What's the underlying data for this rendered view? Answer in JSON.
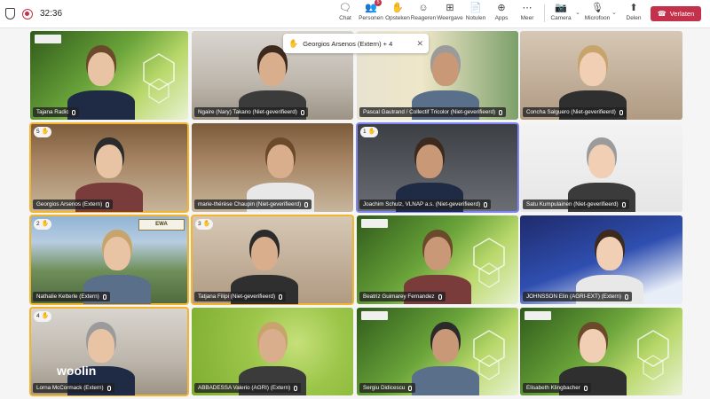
{
  "window": {
    "timer": "32:36"
  },
  "toolbar": {
    "chat": "Chat",
    "people": "Personen",
    "people_badge": "5",
    "raise": "Opsteken",
    "react": "Reageren",
    "view": "Weergave",
    "notes": "Notulen",
    "apps": "Apps",
    "more": "Meer",
    "camera": "Camera",
    "mic": "Microfoon",
    "share": "Delen",
    "leave": "Verlaten"
  },
  "raised_banner": {
    "text": "Georgios Arsenos (Extern) + 4"
  },
  "colors": {
    "leave": "#c4314b",
    "speaking": "#f3b52d",
    "selected": "#7f85f5"
  },
  "participants": [
    {
      "name": "Tajana Radic",
      "bg": "plant",
      "hand": ""
    },
    {
      "name": "Ngaire (Nary) Takano (Niet-geverifieerd)",
      "bg": "office",
      "hand": ""
    },
    {
      "name": "Pascal Gautrand / Collectif Tricolor (Niet-geverifieerd)",
      "bg": "poster",
      "hand": ""
    },
    {
      "name": "Concha Salguero (Niet-geverifieerd)",
      "bg": "room",
      "hand": ""
    },
    {
      "name": "Georgios Arsenos (Extern)",
      "bg": "books",
      "hand": "5"
    },
    {
      "name": "marie-thérèse Chaupin (Niet-geverifieerd)",
      "bg": "books",
      "hand": ""
    },
    {
      "name": "Joachim Schulz, VLNAP a.s. (Niet-geverifieerd)",
      "bg": "dark",
      "hand": "1"
    },
    {
      "name": "Satu Kumpulainen (Niet-geverifieerd)",
      "bg": "white",
      "hand": ""
    },
    {
      "name": "Nathalie Ketterle (Extern)",
      "bg": "mountain",
      "hand": "2"
    },
    {
      "name": "Tatjana Filipi (Niet-geverifieerd)",
      "bg": "room",
      "hand": "3"
    },
    {
      "name": "Beatriz Guimarey Fernandez",
      "bg": "plant",
      "hand": ""
    },
    {
      "name": "JOHNSSON Elin (AGRI-EXT) (Extern)",
      "bg": "blue",
      "hand": ""
    },
    {
      "name": "Lorna McCormack (Extern)",
      "bg": "office",
      "hand": "4"
    },
    {
      "name": "ABBADESSA Valerio (AGRI) (Extern)",
      "bg": "green",
      "hand": ""
    },
    {
      "name": "Sergiu Didicescu",
      "bg": "plant",
      "hand": ""
    },
    {
      "name": "Elisabeth Klingbacher",
      "bg": "plant",
      "hand": ""
    }
  ],
  "tile_texts": {
    "ewa_logo": "EWA",
    "woolin": "woolin"
  }
}
